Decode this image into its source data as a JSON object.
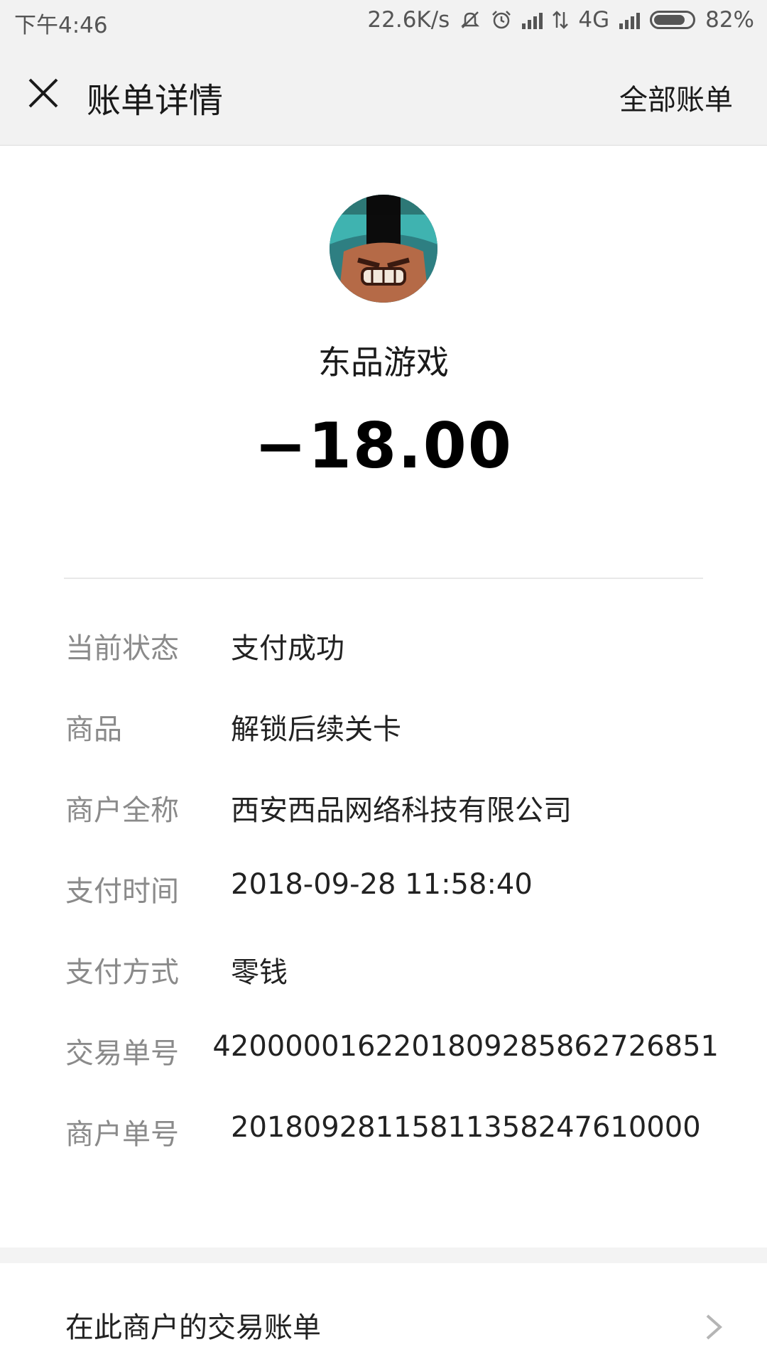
{
  "status_bar": {
    "time": "下午4:46",
    "network_speed": "22.6K/s",
    "network_type": "4G",
    "battery": "82%",
    "battery_level": 0.82
  },
  "nav": {
    "title": "账单详情",
    "all_bills": "全部账单"
  },
  "merchant": {
    "name": "东品游戏",
    "amount": "−18.00"
  },
  "details": [
    {
      "label": "当前状态",
      "value": "支付成功"
    },
    {
      "label": "商品",
      "value": "解锁后续关卡"
    },
    {
      "label": "商户全称",
      "value": "西安西品网络科技有限公司"
    },
    {
      "label": "支付时间",
      "value": "2018-09-28 11:58:40"
    },
    {
      "label": "支付方式",
      "value": "零钱"
    },
    {
      "label": "交易单号",
      "value": "4200000162201809285862726851"
    },
    {
      "label": "商户单号",
      "value": "20180928115811358247610000"
    }
  ],
  "merchant_link": {
    "label": "在此商户的交易账单"
  },
  "colors": {
    "bar_bg": "#f2f2f2",
    "label_gray": "#8a8a8a",
    "text_dark": "#1a1a1a"
  }
}
